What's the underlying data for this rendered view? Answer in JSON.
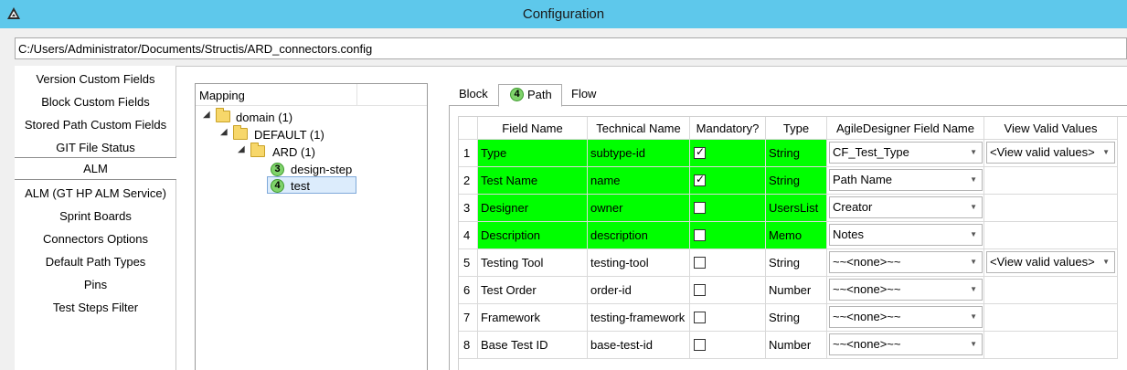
{
  "window": {
    "title": "Configuration"
  },
  "config_path": "C:/Users/Administrator/Documents/Structis/ARD_connectors.config",
  "nav": [
    "Version Custom Fields",
    "Block Custom Fields",
    "Stored Path Custom Fields",
    "GIT File Status",
    "ALM",
    "ALM (GT HP ALM Service)",
    "Sprint Boards",
    "Connectors Options",
    "Default Path Types",
    "Pins",
    "Test Steps Filter"
  ],
  "nav_selected": "ALM",
  "tree": {
    "header": "Mapping",
    "nodes": [
      {
        "label": "domain (1)"
      },
      {
        "label": "DEFAULT (1)"
      },
      {
        "label": "ARD (1)"
      },
      {
        "label": "design-step",
        "badge": "3"
      },
      {
        "label": "test",
        "badge": "4"
      }
    ]
  },
  "tabs": [
    {
      "label": "Block"
    },
    {
      "label": "Path",
      "badge": "4"
    },
    {
      "label": "Flow"
    }
  ],
  "grid": {
    "columns": [
      "Field Name",
      "Technical Name",
      "Mandatory?",
      "Type",
      "AgileDesigner Field Name",
      "View Valid Values"
    ],
    "rows": [
      {
        "num": "1",
        "field": "Type",
        "tech": "subtype-id",
        "mandatory": true,
        "type": "String",
        "ad_field": "CF_Test_Type",
        "valid": "<View valid values>",
        "highlight": true
      },
      {
        "num": "2",
        "field": "Test Name",
        "tech": "name",
        "mandatory": true,
        "type": "String",
        "ad_field": "Path Name",
        "valid": "",
        "highlight": true
      },
      {
        "num": "3",
        "field": "Designer",
        "tech": "owner",
        "mandatory": false,
        "type": "UsersList",
        "ad_field": "Creator",
        "valid": "",
        "highlight": true
      },
      {
        "num": "4",
        "field": "Description",
        "tech": "description",
        "mandatory": false,
        "type": "Memo",
        "ad_field": "Notes",
        "valid": "",
        "highlight": true
      },
      {
        "num": "5",
        "field": "Testing Tool",
        "tech": "testing-tool",
        "mandatory": false,
        "type": "String",
        "ad_field": "~~<none>~~",
        "valid": "<View valid values>",
        "highlight": false
      },
      {
        "num": "6",
        "field": "Test Order",
        "tech": "order-id",
        "mandatory": false,
        "type": "Number",
        "ad_field": "~~<none>~~",
        "valid": "",
        "highlight": false
      },
      {
        "num": "7",
        "field": "Framework",
        "tech": "testing-framework",
        "mandatory": false,
        "type": "String",
        "ad_field": "~~<none>~~",
        "valid": "",
        "highlight": false
      },
      {
        "num": "8",
        "field": "Base Test ID",
        "tech": "base-test-id",
        "mandatory": false,
        "type": "Number",
        "ad_field": "~~<none>~~",
        "valid": "",
        "highlight": false
      }
    ]
  },
  "colors": {
    "titlebar": "#5ec8eb",
    "highlight": "#00ff00",
    "badge": "#7fd36b"
  }
}
